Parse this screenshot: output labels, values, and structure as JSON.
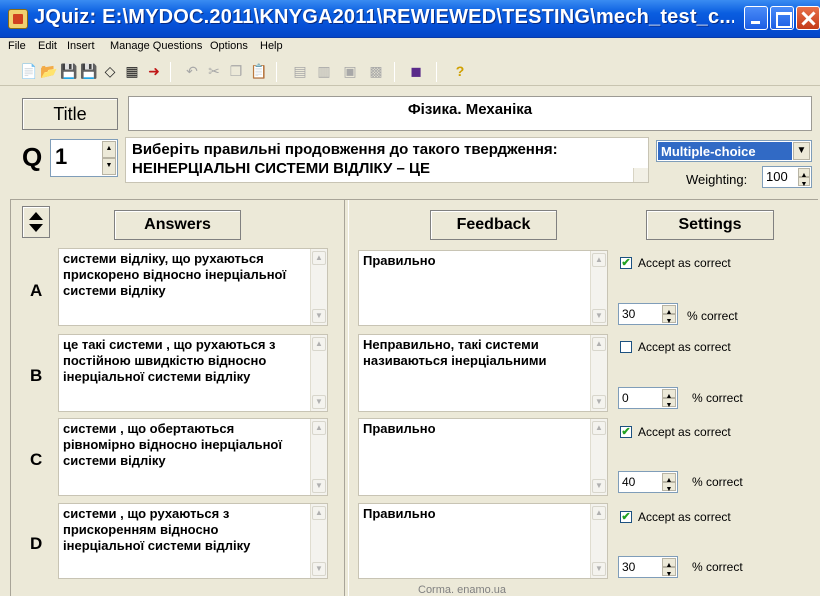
{
  "window": {
    "title": "JQuiz: E:\\MYDOC.2011\\KNYGA2011\\REWIEWED\\TESTING\\mech_test_c..."
  },
  "menu": [
    "File",
    "Edit",
    "Insert",
    "Manage Questions",
    "Options",
    "Help"
  ],
  "header": {
    "title_button": "Title",
    "title_value": "Фізика. Механіка",
    "q_label": "Q",
    "q_number": "1",
    "question": "Виберіть правильні продовження до такого твердження:\nНЕІНЕРЦІАЛЬНІ СИСТЕМИ ВІДЛІКУ – ЦЕ",
    "question_type": "Multiple-choice",
    "weighting_label": "Weighting:",
    "weighting_value": "100"
  },
  "columns": {
    "answers": "Answers",
    "feedback": "Feedback",
    "settings": "Settings"
  },
  "answers": [
    {
      "letter": "A",
      "text": "системи відліку, що рухаються прискорено відносно інерціальної системи відліку",
      "feedback": "Правильно",
      "accept_label": "Accept as correct",
      "accepted": true,
      "percent": "30",
      "percent_label": "% correct"
    },
    {
      "letter": "B",
      "text": "це такі системи , що рухаються з постійною швидкістю відносно інерціальної системи відліку",
      "feedback": "Неправильно, такі системи називаються інерціальними",
      "accept_label": "Accept as correct",
      "accepted": false,
      "percent": "0",
      "percent_label": "% correct"
    },
    {
      "letter": "C",
      "text": "системи , що обертаються рівномірно відносно інерціальної системи відліку",
      "feedback": "Правильно",
      "accept_label": "Accept as correct",
      "accepted": true,
      "percent": "40",
      "percent_label": "% correct"
    },
    {
      "letter": "D",
      "text": "системи , що рухаються з прискоренням відносно інерціальної системи відліку",
      "feedback": "Правильно",
      "accept_label": "Accept as correct",
      "accepted": true,
      "percent": "30",
      "percent_label": "% correct"
    }
  ],
  "footer": "Corma. enamo.ua",
  "colors": {
    "titlebar": "#0a5ee0",
    "selection": "#316ac5",
    "window_bg": "#ece9d8"
  },
  "toolbar_icons": [
    "new-icon",
    "open-icon",
    "save-icon",
    "save-as-icon",
    "clear-icon",
    "grid-icon",
    "insert-arrow-icon",
    "undo-icon",
    "cut-icon",
    "copy-icon",
    "paste-icon",
    "export-web-icon",
    "export-print-icon",
    "export-a-icon",
    "export-b-icon",
    "config-icon",
    "help-icon"
  ]
}
